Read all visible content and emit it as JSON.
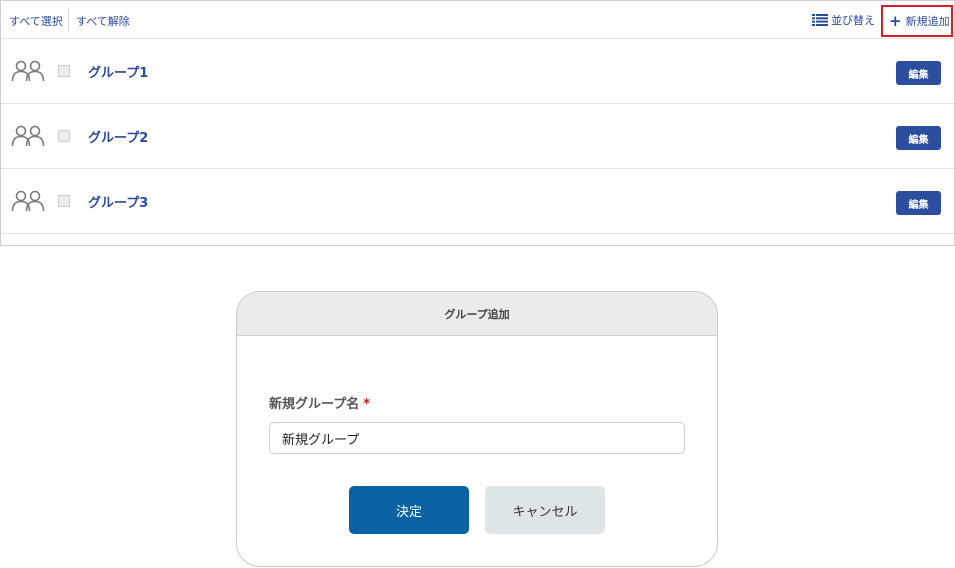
{
  "toolbar": {
    "select_all": "すべて選択",
    "deselect_all": "すべて解除",
    "sort_label": "並び替え",
    "sort_icon": "list-icon",
    "add_icon": "plus-icon",
    "add_label": "新規追加"
  },
  "groups": [
    {
      "name": "グループ1",
      "edit_label": "編集",
      "icon": "group-icon"
    },
    {
      "name": "グループ2",
      "edit_label": "編集",
      "icon": "group-icon"
    },
    {
      "name": "グループ3",
      "edit_label": "編集",
      "icon": "group-icon"
    }
  ],
  "dialog": {
    "title": "グループ追加",
    "field_label": "新規グループ名",
    "required_mark": "*",
    "input_value": "新規グループ",
    "ok_label": "決定",
    "cancel_label": "キャンセル"
  },
  "colors": {
    "link": "#2b4a9a",
    "edit_button": "#2c4e9e",
    "ok_button": "#0a62a3",
    "cancel_button": "#dde5e8",
    "highlight_border": "#d0202a"
  }
}
